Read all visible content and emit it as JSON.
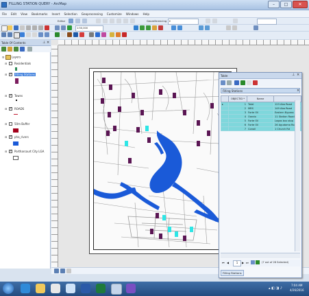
{
  "window": {
    "title": "FILLING STATION QUERY - ArcMap"
  },
  "menus": [
    "File",
    "Edit",
    "View",
    "Bookmarks",
    "Insert",
    "Selection",
    "Geoprocessing",
    "Customize",
    "Windows",
    "Help"
  ],
  "toolbar": {
    "editor_label": "Editor",
    "scale_value": "1:50,000",
    "georef_label": "Georeferencing"
  },
  "toc": {
    "title": "Table Of Contents",
    "root_label": "Layers",
    "layers": [
      {
        "name": "Residentials",
        "checked": false,
        "swatch": "#2e8b57"
      },
      {
        "name": "Filling Stations",
        "checked": true,
        "selected": true,
        "swatch": "#7b1c5e"
      },
      {
        "name": "Towns",
        "checked": true,
        "swatch": "#111111"
      },
      {
        "name": "ROADS",
        "checked": true,
        "swatch": "#c0172e"
      },
      {
        "name": "50m Buffer",
        "checked": false,
        "swatch": "#a3001b"
      },
      {
        "name": "pha_rivers",
        "checked": true,
        "swatch": "#1a5ad8"
      },
      {
        "name": "Portharcourt City LGA",
        "checked": true,
        "swatch": "#ffffff"
      }
    ]
  },
  "attribute_table": {
    "window_title": "Table",
    "layer_tab": "Filling Stations",
    "columns": [
      "",
      "OBJECTID *",
      "Name",
      ""
    ],
    "rows": [
      [
        "",
        "1",
        "Total",
        "123 Aba Road"
      ],
      [
        "",
        "2",
        "MRS",
        "149 Aba Road"
      ],
      [
        "",
        "3",
        "Forte Oil",
        "Eastern Bypass"
      ],
      [
        "",
        "4",
        "Oando",
        "11 Station Road"
      ],
      [
        "",
        "5",
        "Forte Oil",
        "Lagos bus stop"
      ],
      [
        "",
        "6",
        "Forte Oil",
        "26 Agudama Road"
      ],
      [
        "",
        "7",
        "Conoil",
        "1 Church Rd"
      ]
    ],
    "record_status": "(7 out of 28 Selected)",
    "record_nav": "1"
  },
  "taskbar": {
    "time": "7:04 AM",
    "date": "4/26/2016"
  },
  "colors": {
    "river": "#1a5ad8",
    "station": "#5a1553",
    "selected": "#2ee6e6",
    "table_sel": "#7fd7dc"
  }
}
